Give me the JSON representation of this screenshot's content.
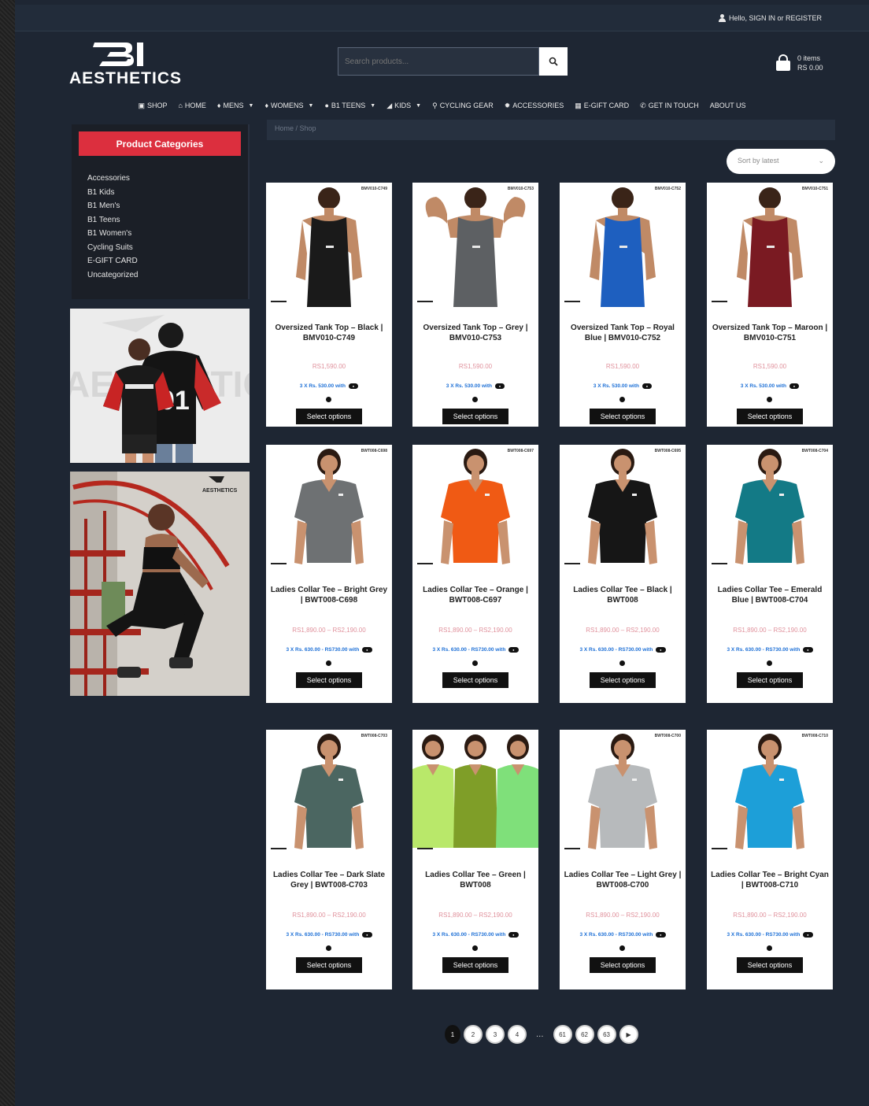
{
  "topbar": {
    "account_text": "Hello, SIGN IN or REGISTER"
  },
  "header": {
    "logo_text": "AESTHETICS",
    "search_placeholder": "Search products...",
    "cart_items": "0 items",
    "cart_total": "RS 0.00"
  },
  "nav": {
    "items": [
      {
        "label": "SHOP",
        "icon": "store-icon",
        "caret": false
      },
      {
        "label": "HOME",
        "icon": "home-icon",
        "caret": false
      },
      {
        "label": "MENS",
        "icon": "male-icon",
        "caret": true
      },
      {
        "label": "WOMENS",
        "icon": "female-icon",
        "caret": true
      },
      {
        "label": "B1 TEENS",
        "icon": "circle-icon",
        "caret": true
      },
      {
        "label": "KIDS",
        "icon": "kids-icon",
        "caret": true
      },
      {
        "label": "CYCLING GEAR",
        "icon": "bike-icon",
        "caret": false
      },
      {
        "label": "ACCESSORIES",
        "icon": "gear-icon",
        "caret": false
      },
      {
        "label": "E-GIFT CARD",
        "icon": "gift-icon",
        "caret": false
      },
      {
        "label": "GET IN TOUCH",
        "icon": "phone-icon",
        "caret": false
      },
      {
        "label": "ABOUT US",
        "icon": "",
        "caret": false
      }
    ]
  },
  "sidebar": {
    "header": "Product Categories",
    "categories": [
      "Accessories",
      "B1 Kids",
      "B1 Men's",
      "B1 Teens",
      "B1 Women's",
      "Cycling Suits",
      "E-GIFT CARD",
      "Uncategorized"
    ]
  },
  "main": {
    "breadcrumb": "Home / Shop",
    "sort_label": "Sort by latest",
    "button_label": "Select options",
    "products": [
      {
        "title": "Oversized Tank Top – Black | BMV010-C749",
        "price": "RS1,590.00",
        "installment": "3 X Rs. 530.00 with",
        "sku": "BMV010-C749",
        "garment": "tank",
        "color": "#1a1a1a"
      },
      {
        "title": "Oversized Tank Top – Grey | BMV010-C753",
        "price": "RS1,590.00",
        "installment": "3 X Rs. 530.00 with",
        "sku": "BMV010-C753",
        "garment": "tank",
        "color": "#5d6063"
      },
      {
        "title": "Oversized Tank Top – Royal Blue | BMV010-C752",
        "price": "RS1,590.00",
        "installment": "3 X Rs. 530.00 with",
        "sku": "BMV010-C752",
        "garment": "tank",
        "color": "#1e5fbf"
      },
      {
        "title": "Oversized Tank Top – Maroon | BMV010-C751",
        "price": "RS1,590.00",
        "installment": "3 X Rs. 530.00 with",
        "sku": "BMV010-C751",
        "garment": "tank",
        "color": "#7a1a22"
      },
      {
        "title": "Ladies Collar Tee – Bright Grey | BWT008-C698",
        "price": "RS1,890.00 – RS2,190.00",
        "installment": "3 X Rs. 630.00 - RS730.00 with",
        "sku": "BWT008-C698",
        "garment": "polo",
        "color": "#6e7173"
      },
      {
        "title": "Ladies Collar Tee – Orange | BWT008-C697",
        "price": "RS1,890.00 – RS2,190.00",
        "installment": "3 X Rs. 630.00 - RS730.00 with",
        "sku": "BWT008-C697",
        "garment": "polo",
        "color": "#f05a14"
      },
      {
        "title": "Ladies Collar Tee – Black | BWT008",
        "price": "RS1,890.00 – RS2,190.00",
        "installment": "3 X Rs. 630.00 - RS730.00 with",
        "sku": "BWT008-C695",
        "garment": "polo",
        "color": "#161616"
      },
      {
        "title": "Ladies Collar Tee – Emerald Blue | BWT008-C704",
        "price": "RS1,890.00 – RS2,190.00",
        "installment": "3 X Rs. 630.00 - RS730.00 with",
        "sku": "BWT008-C704",
        "garment": "polo",
        "color": "#137a86"
      },
      {
        "title": "Ladies Collar Tee – Dark Slate Grey | BWT008-C703",
        "price": "RS1,890.00 – RS2,190.00",
        "installment": "3 X Rs. 630.00 - RS730.00 with",
        "sku": "BWT008-C703",
        "garment": "polo",
        "color": "#4b6661"
      },
      {
        "title": "Ladies Collar Tee – Green | BWT008",
        "price": "RS1,890.00 – RS2,190.00",
        "installment": "3 X Rs. 630.00 - RS730.00 with",
        "sku": "",
        "garment": "polo3",
        "color": "#8aa52a"
      },
      {
        "title": "Ladies Collar Tee – Light Grey | BWT008-C700",
        "price": "RS1,890.00 – RS2,190.00",
        "installment": "3 X Rs. 630.00 - RS730.00 with",
        "sku": "BWT008-C700",
        "garment": "polo",
        "color": "#b7babc"
      },
      {
        "title": "Ladies Collar Tee – Bright Cyan | BWT008-C710",
        "price": "RS1,890.00 – RS2,190.00",
        "installment": "3 X Rs. 630.00 - RS730.00 with",
        "sku": "BWT008-C710",
        "garment": "polo",
        "color": "#1d9fd8"
      }
    ]
  },
  "pagination": {
    "pages": [
      "1",
      "2",
      "3",
      "4",
      "61",
      "62",
      "63"
    ],
    "current": "1",
    "ellipsis": "...",
    "next_icon": "chevron-right-icon"
  },
  "colors": {
    "accent_red": "#dc2f3e",
    "page_bg": "#1e2633",
    "price_pink": "#e0929d",
    "installment_blue": "#1c6fd6"
  }
}
